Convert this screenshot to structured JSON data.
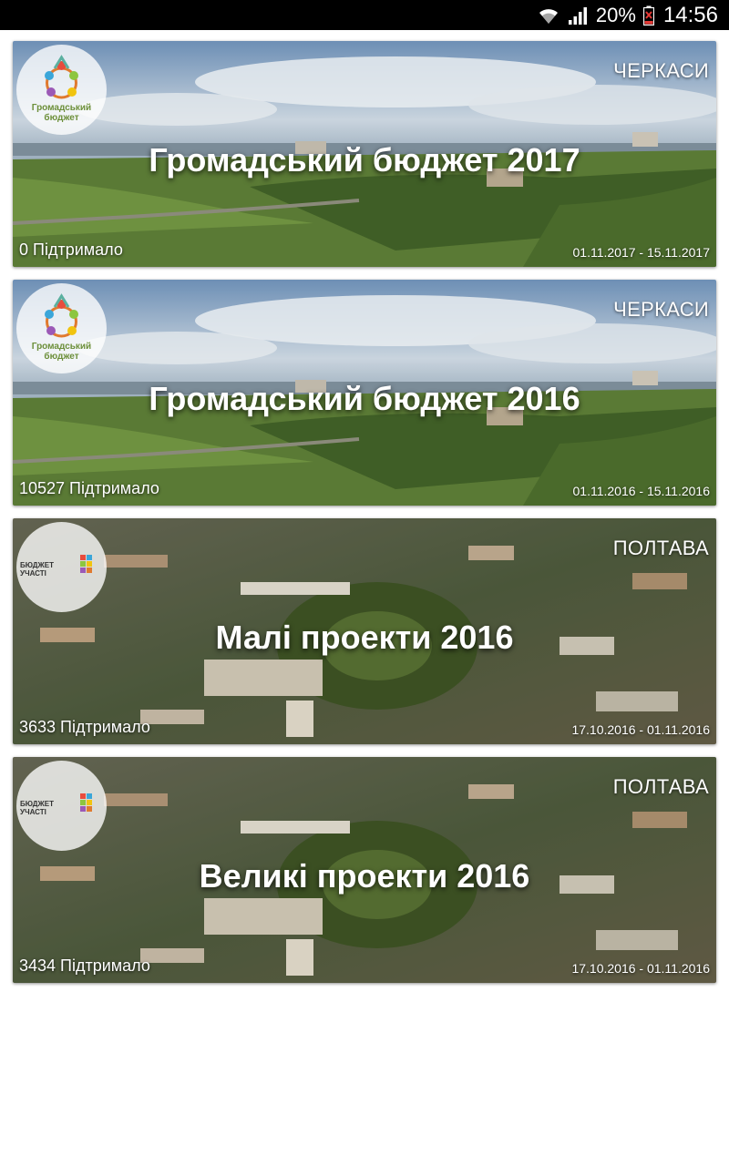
{
  "status_bar": {
    "battery": "20%",
    "time": "14:56",
    "icons": [
      "wifi-icon",
      "signal-icon",
      "battery-low-icon"
    ]
  },
  "cards": [
    {
      "city": "ЧЕРКАСИ",
      "title": "Громадський бюджет 2017",
      "supported": "0 Підтримало",
      "dates": "01.11.2017 - 15.11.2017",
      "logo": "Громадський бюджет",
      "background": "cherkasy-panorama"
    },
    {
      "city": "ЧЕРКАСИ",
      "title": "Громадський бюджет 2016",
      "supported": "10527 Підтримало",
      "dates": "01.11.2016 - 15.11.2016",
      "logo": "Громадський бюджет",
      "background": "cherkasy-panorama"
    },
    {
      "city": "ПОЛТАВА",
      "title": "Малі проекти 2016",
      "supported": "3633 Підтримало",
      "dates": "17.10.2016 - 01.11.2016",
      "logo": "БЮДЖЕТ УЧАСТІ",
      "background": "poltava-aerial"
    },
    {
      "city": "ПОЛТАВА",
      "title": "Великі проекти 2016",
      "supported": "3434 Підтримало",
      "dates": "17.10.2016 - 01.11.2016",
      "logo": "БЮДЖЕТ УЧАСТІ",
      "background": "poltava-aerial"
    }
  ]
}
